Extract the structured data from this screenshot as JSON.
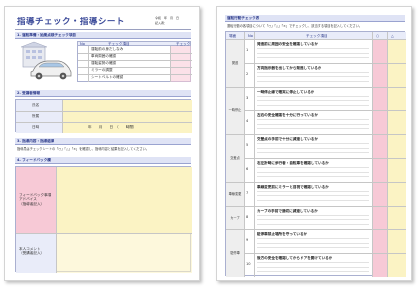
{
  "page1": {
    "title": "指導チェック・指導シート",
    "date_label": "令和　年　月　日",
    "recorder_label": "記入者：　　　　　　",
    "section1_heading": "1. 運転準備・始業点検チェック項目",
    "s1_table_headers": [
      "No",
      "チェック項目",
      "チェック"
    ],
    "s1_rows": [
      "運転前の身だしなみ",
      "車両周囲の確認",
      "運転姿勢の確認",
      "ミラーの調整",
      "シートベルトの確認"
    ],
    "section2_heading": "2. 受講者情報",
    "info_labels": [
      "氏名",
      "所属",
      "日時"
    ],
    "info_date_text": "年　　月　　日　（　　時間）",
    "section3_heading": "3. 指導内容・指導結果",
    "section3_note": "指導員はチェックシートの「○」「△」「×」を確認し、指導内容と結果を記入してください。",
    "section4_heading": "4. フィードバック欄",
    "fb_labels": [
      "フィードバック事項\nアドバイス\n（指導者記入）",
      "本人コメント\n（受講者記入）"
    ]
  },
  "page2": {
    "title": "運転行動チェック表",
    "instruction": "運転行動の各項目について「○」「△」「×」でチェックし、該当する項目を記入してください。",
    "headers": [
      "場面",
      "No",
      "チェック項目",
      "○",
      "△"
    ],
    "scenes": [
      "発進",
      "一時停止",
      "交差点",
      "車線変更",
      "カーブ",
      "駐停車"
    ],
    "items": [
      "発進前に周囲の安全を確認しているか",
      "方向指示器を出してから発進しているか",
      "一時停止線で確実に停止しているか",
      "左右の安全確認を十分に行っているか",
      "交差点の手前で十分に減速しているか",
      "右左折時に歩行者・自転車を確認しているか",
      "車線変更前にミラーと目視で確認しているか",
      "カーブの手前で適切に減速しているか",
      "駐停車禁止場所を守っているか",
      "後方の安全を確認してからドアを開けているか"
    ]
  },
  "colors": {
    "accent": "#3b4a99",
    "header_fill": "#dfe3f5",
    "band_blue": "#e9ecf9",
    "band_yellow": "#fbf3c4",
    "band_pink": "#f7c9d6"
  }
}
